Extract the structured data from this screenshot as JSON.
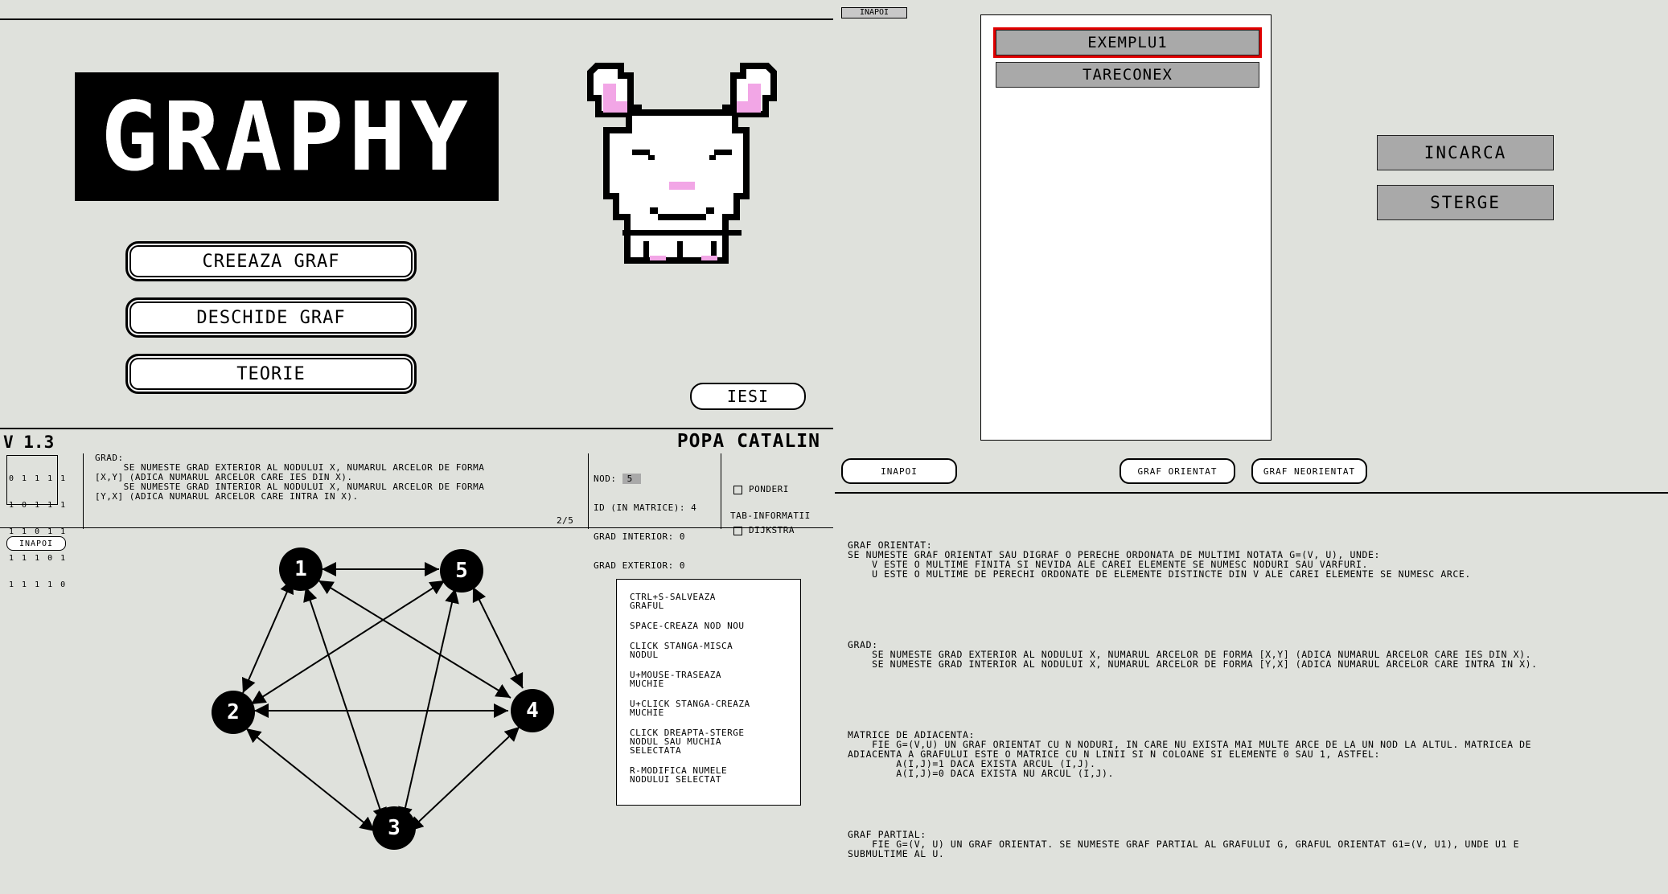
{
  "main_menu": {
    "logo_text": "GRAPHY",
    "buttons": [
      "CREEAZA GRAF",
      "DESCHIDE GRAF",
      "TEORIE"
    ],
    "exit_label": "IESI",
    "mascot_icon": "pixel-bunny-mascot"
  },
  "info_bar": {
    "version": "V 1.3",
    "author": "POPA CATALIN",
    "matrix": [
      "0 1 1 1 1",
      "1 0 1 1 1",
      "1 1 0 1 1",
      "1 1 1 0 1",
      "1 1 1 1 0"
    ],
    "tip_text": "GRAD:\n     SE NUMESTE GRAD EXTERIOR AL NODULUI X, NUMARUL ARCELOR DE FORMA\n[X,Y] (ADICA NUMARUL ARCELOR CARE IES DIN X).\n     SE NUMESTE GRAD INTERIOR AL NODULUI X, NUMARUL ARCELOR DE FORMA\n[Y,X] (ADICA NUMARUL ARCELOR CARE INTRA IN X).",
    "page": "2/5",
    "node_label": "NOD:",
    "node_value": "5",
    "matrix_id": "ID (IN MATRICE): 4",
    "grad_interior": "GRAD INTERIOR: 0",
    "grad_exterior": "GRAD EXTERIOR: 0",
    "options": [
      "PONDERI",
      "DIJKSTRA"
    ],
    "tab_hint": "TAB-INFORMATII"
  },
  "graph_view": {
    "back_label": "INAPOI",
    "nodes": [
      "1",
      "5",
      "2",
      "4",
      "3"
    ],
    "help_items": [
      "CTRL+S-SALVEAZA\nGRAFUL",
      "SPACE-CREAZA NOD NOU",
      "CLICK STANGA-MISCA\nNODUL",
      "U+MOUSE-TRASEAZA\nMUCHIE",
      "U+CLICK STANGA-CREAZA\nMUCHIE",
      "CLICK DREAPTA-STERGE\nNODUL SAU MUCHIA\nSELECTATA",
      "R-MODIFICA NUMELE\nNODULUI SELECTAT"
    ]
  },
  "file_browser": {
    "back_label": "INAPOI",
    "files": [
      "EXEMPLU1",
      "TARECONEX"
    ],
    "selected_index": 0,
    "load_label": "INCARCA",
    "delete_label": "STERGE"
  },
  "theory": {
    "back_label": "INAPOI",
    "tab_directed": "GRAF ORIENTAT",
    "tab_undirected": "GRAF NEORIENTAT",
    "sections": [
      "GRAF ORIENTAT:\nSE NUMESTE GRAF ORIENTAT SAU DIGRAF O PERECHE ORDONATA DE MULTIMI NOTATA G=(V, U), UNDE:\n    V ESTE O MULTIME FINITA SI NEVIDA ALE CAREI ELEMENTE SE NUMESC NODURI SAU VARFURI.\n    U ESTE O MULTIME DE PERECHI ORDONATE DE ELEMENTE DISTINCTE DIN V ALE CAREI ELEMENTE SE NUMESC ARCE.",
      "GRAD:\n    SE NUMESTE GRAD EXTERIOR AL NODULUI X, NUMARUL ARCELOR DE FORMA [X,Y] (ADICA NUMARUL ARCELOR CARE IES DIN X).\n    SE NUMESTE GRAD INTERIOR AL NODULUI X, NUMARUL ARCELOR DE FORMA [Y,X] (ADICA NUMARUL ARCELOR CARE INTRA IN X).",
      "MATRICE DE ADIACENTA:\n    FIE G=(V,U) UN GRAF ORIENTAT CU N NODURI, IN CARE NU EXISTA MAI MULTE ARCE DE LA UN NOD LA ALTUL. MATRICEA DE\nADIACENTA A GRAFULUI ESTE O MATRICE CU N LINII SI N COLOANE SI ELEMENTE 0 SAU 1, ASTFEL:\n        A(I,J)=1 DACA EXISTA ARCUL (I,J).\n        A(I,J)=0 DACA EXISTA NU ARCUL (I,J).",
      "GRAF PARTIAL:\n    FIE G=(V, U) UN GRAF ORIENTAT. SE NUMESTE GRAF PARTIAL AL GRAFULUI G, GRAFUL ORIENTAT G1=(V, U1), UNDE U1 E\nSUBMULTIME AL U."
    ]
  }
}
